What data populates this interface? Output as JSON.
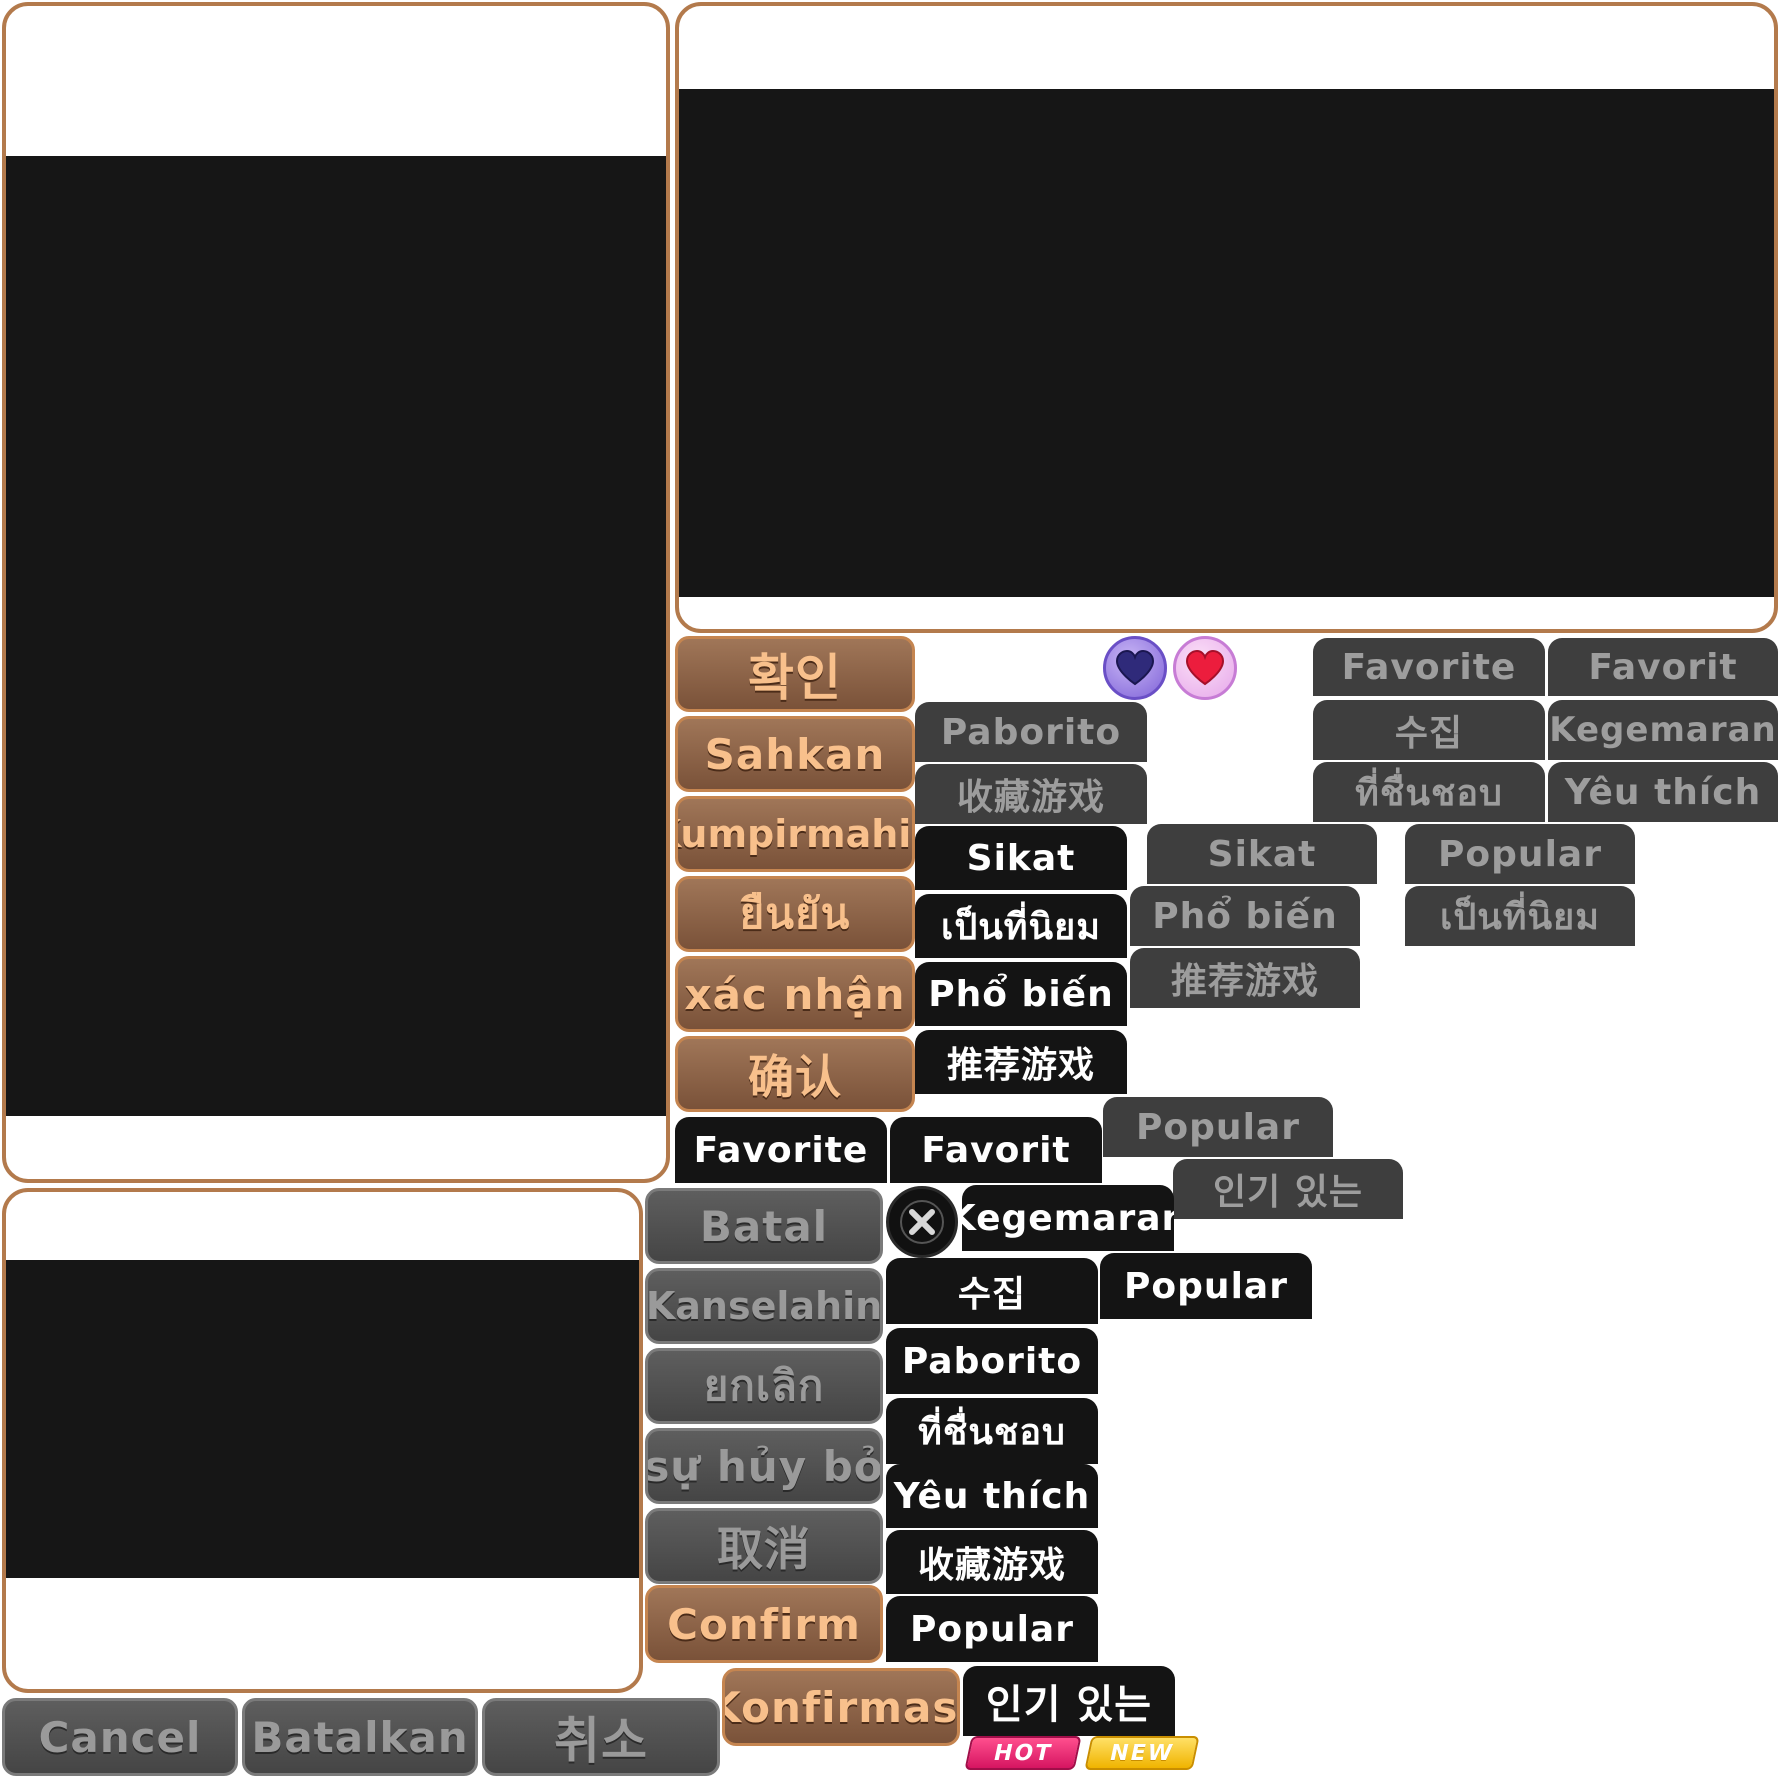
{
  "confirm_buttons": [
    "확인",
    "Sahkan",
    "Kumpirmahin",
    "ยืนยัน",
    "xác nhận",
    "确认",
    "Confirm",
    "Konfirmasi"
  ],
  "cancel_buttons": [
    "Batal",
    "Kanselahin",
    "ยกเลิก",
    "sự hủy bỏ",
    "取消",
    "Cancel",
    "Batalkan",
    "취소"
  ],
  "dim_tags": {
    "paborito": "Paborito",
    "shoucang": "收藏游戏",
    "favorite_a": "Favorite",
    "favorit_a": "Favorit",
    "sujip": "수집",
    "kegemaran": "Kegemaran",
    "thai_fav": "ที่ชื่นชอบ",
    "yeu_thich": "Yêu thích",
    "sikat": "Sikat",
    "popular_a": "Popular",
    "pho_bien": "Phổ biến",
    "thai_pop": "เป็นที่นิยม",
    "tuijian": "推荐游戏",
    "popular_b": "Popular",
    "ingi": "인기 있는"
  },
  "dark_tags": {
    "sikat": "Sikat",
    "thai_pop": "เป็นที่นิยม",
    "pho_bien": "Phổ biến",
    "tuijian": "推荐游戏",
    "favorite": "Favorite",
    "favorit": "Favorit",
    "kegemaran": "Kegemaran",
    "popular_a": "Popular",
    "sujip": "수집",
    "paborito": "Paborito",
    "thai_fav": "ที่ชื่นชอบ",
    "yeu_thich": "Yêu thích",
    "shoucang": "收藏游戏",
    "popular_b": "Popular",
    "ingi": "인기 있는"
  },
  "badges": {
    "hot": "HOT",
    "new": "NEW"
  },
  "icons": {
    "heart_off": "heart-outline-icon",
    "heart_on": "heart-filled-icon",
    "close": "close-icon"
  },
  "colors": {
    "accent": "#b37a4c",
    "confirm_text": "#f8c08c",
    "cancel_text": "#9a9a9a",
    "hot": "#e8246b",
    "new": "#f5c31a"
  }
}
